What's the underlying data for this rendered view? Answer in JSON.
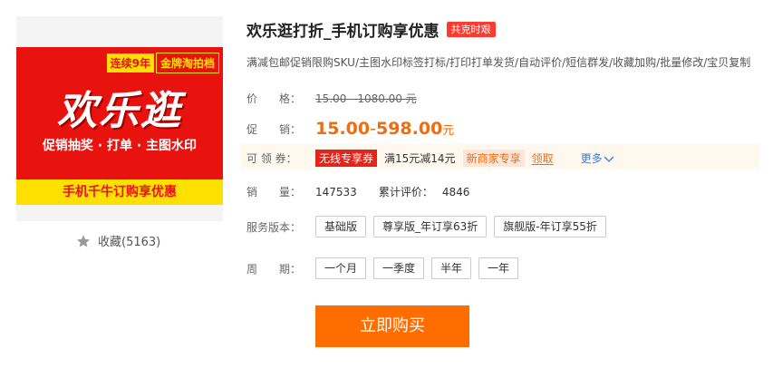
{
  "image": {
    "years": "连续9年",
    "brand": "金牌淘拍档",
    "big_text": "欢乐逛",
    "sub_text": "促销抽奖 · 打单 · 主图水印",
    "foot_text": "手机千牛订购享优惠"
  },
  "favorite": {
    "icon": "star-icon",
    "label": "收藏(5163)"
  },
  "product": {
    "title": "欢乐逛打折_手机订购享优惠",
    "badge": "共克时艰",
    "subtitle": "满减包邮促销限购SKU/主图水印标签打标/打印打单发货/自动评价/短信群发/收藏加购/批量修改/宝贝复制"
  },
  "price": {
    "label": "价　　格：",
    "original": "15.00 - 1080.00 元"
  },
  "promo": {
    "label": "促　　销：",
    "min": "15.00",
    "sep": " - ",
    "max": "598.00",
    "unit": "元"
  },
  "coupon": {
    "label": "可 领 券：",
    "tag_a": "无线",
    "tag_b": "专享券",
    "text": "满15元减14元",
    "new_tag": "新商家专享",
    "claim": "领取",
    "more": "更多"
  },
  "sales": {
    "label": "销　　量：",
    "count": "147533",
    "review_label": "累计评价：",
    "review_count": "4846"
  },
  "version": {
    "label": "服务版本：",
    "options": [
      "基础版",
      "尊享版_年订享63折",
      "旗舰版-年订享55折"
    ]
  },
  "period": {
    "label": "周　　期：",
    "options": [
      "一个月",
      "一季度",
      "半年",
      "一年"
    ]
  },
  "buy_label": "立即购买",
  "colors": {
    "accent": "#ff6d00",
    "price": "#f06d0f",
    "banner_red": "#e8130f",
    "banner_yellow": "#fde000"
  }
}
